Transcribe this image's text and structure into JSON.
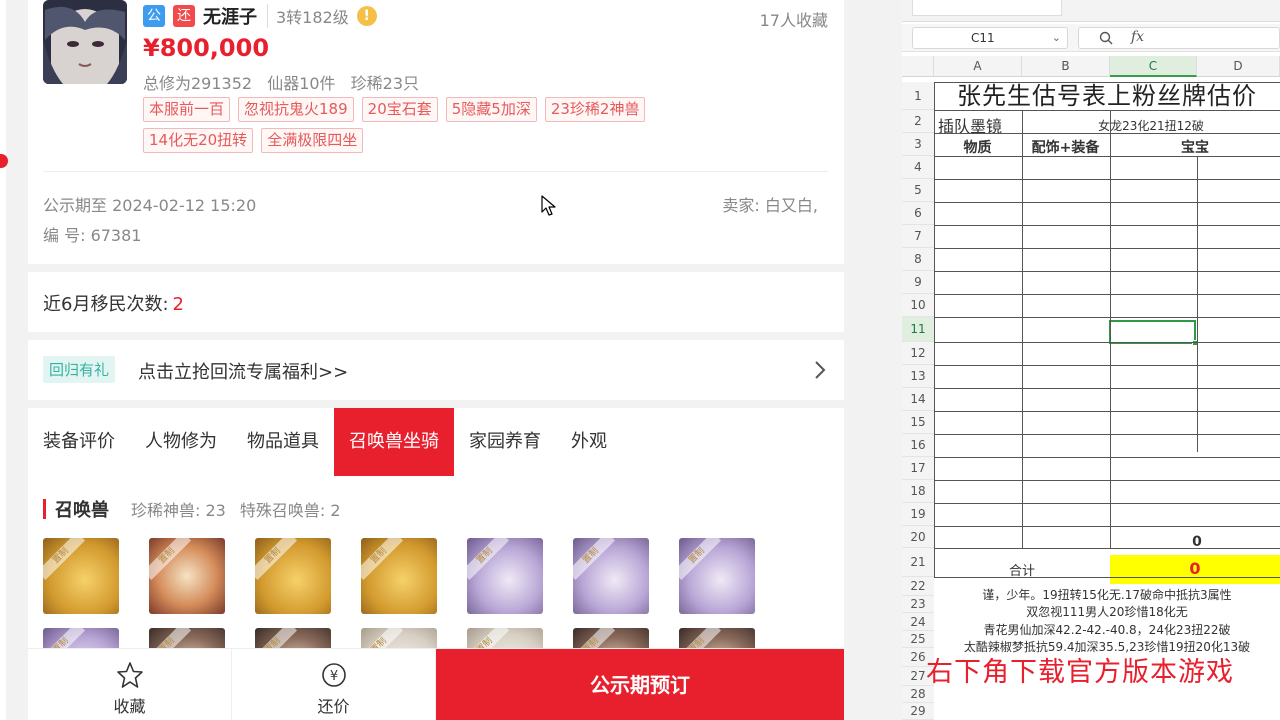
{
  "listing": {
    "badge_public": "公",
    "badge_bargain": "还",
    "role_name": "无涯子",
    "level": "3转182级",
    "info_icon": "!",
    "favorites": "17人收藏",
    "price": "¥800,000",
    "stats": [
      "总修为291352",
      "仙器10件",
      "珍稀23只"
    ],
    "tags": [
      "本服前一百",
      "忽视抗鬼火189",
      "20宝石套",
      "5隐藏5加深",
      "23珍稀2神兽",
      "14化无20扭转",
      "全满极限四坐"
    ],
    "notice": "公示期至 2024-02-12 15:20",
    "seller": "卖家: 白又白,",
    "serial": "编 号: 67381"
  },
  "migrate": {
    "label": "近6月移民次数:",
    "value": "2"
  },
  "return_promo": {
    "badge": "回归有礼",
    "text": "点击立抢回流专属福利>>"
  },
  "tabs": [
    {
      "label": "装备评价",
      "active": false
    },
    {
      "label": "人物修为",
      "active": false
    },
    {
      "label": "物品道具",
      "active": false
    },
    {
      "label": "召唤兽坐骑",
      "active": true
    },
    {
      "label": "家园养育",
      "active": false
    },
    {
      "label": "外观",
      "active": false
    }
  ],
  "pets_section": {
    "title": "召唤兽",
    "rare": "珍稀神兽: 23",
    "special": "特殊召唤兽: 2",
    "band_text": "置制",
    "tiles": [
      "gold",
      "warrior",
      "gold",
      "gold",
      "fox",
      "fox",
      "fox",
      "fox",
      "dark",
      "dark",
      "pale",
      "pale",
      "dark",
      "dark"
    ]
  },
  "bottom_bar": {
    "favorite": "收藏",
    "bargain": "还价",
    "bargain_icon": "¥",
    "primary": "公示期预订"
  },
  "spreadsheet": {
    "name_box": "C11",
    "fx_label": "fx",
    "columns": [
      "A",
      "B",
      "C",
      "D"
    ],
    "rows": [
      "1",
      "2",
      "3",
      "4",
      "5",
      "6",
      "7",
      "8",
      "9",
      "10",
      "11",
      "12",
      "13",
      "14",
      "15",
      "16",
      "17",
      "18",
      "19",
      "20",
      "21",
      "22",
      "23",
      "24",
      "25",
      "26",
      "27",
      "28",
      "29"
    ],
    "selected_row": "11",
    "title": "张先生估号表上粉丝牌估价",
    "row2_a": "插队墨镜",
    "row2_bc": "女龙23化21扭12破",
    "header_a": "物质",
    "header_b": "配饰+装备",
    "header_c": "宝宝",
    "row20_c": "0",
    "total_label": "合计",
    "total_value": "0",
    "notes": [
      "谨，少年。19扭转15化无.17破命中抵抗3属性",
      "双忽视111男人20珍惜18化无",
      "青花男仙加深42.2-42.-40.8，24化23扭22破",
      "太酷辣椒梦抵抗59.4加深35.5,23珍惜19扭20化13破"
    ]
  },
  "overlay": "右下角下载官方版本游戏",
  "colors": {
    "accent": "#e8202e",
    "selection": "#2e9a44",
    "highlight": "#ffff00"
  }
}
